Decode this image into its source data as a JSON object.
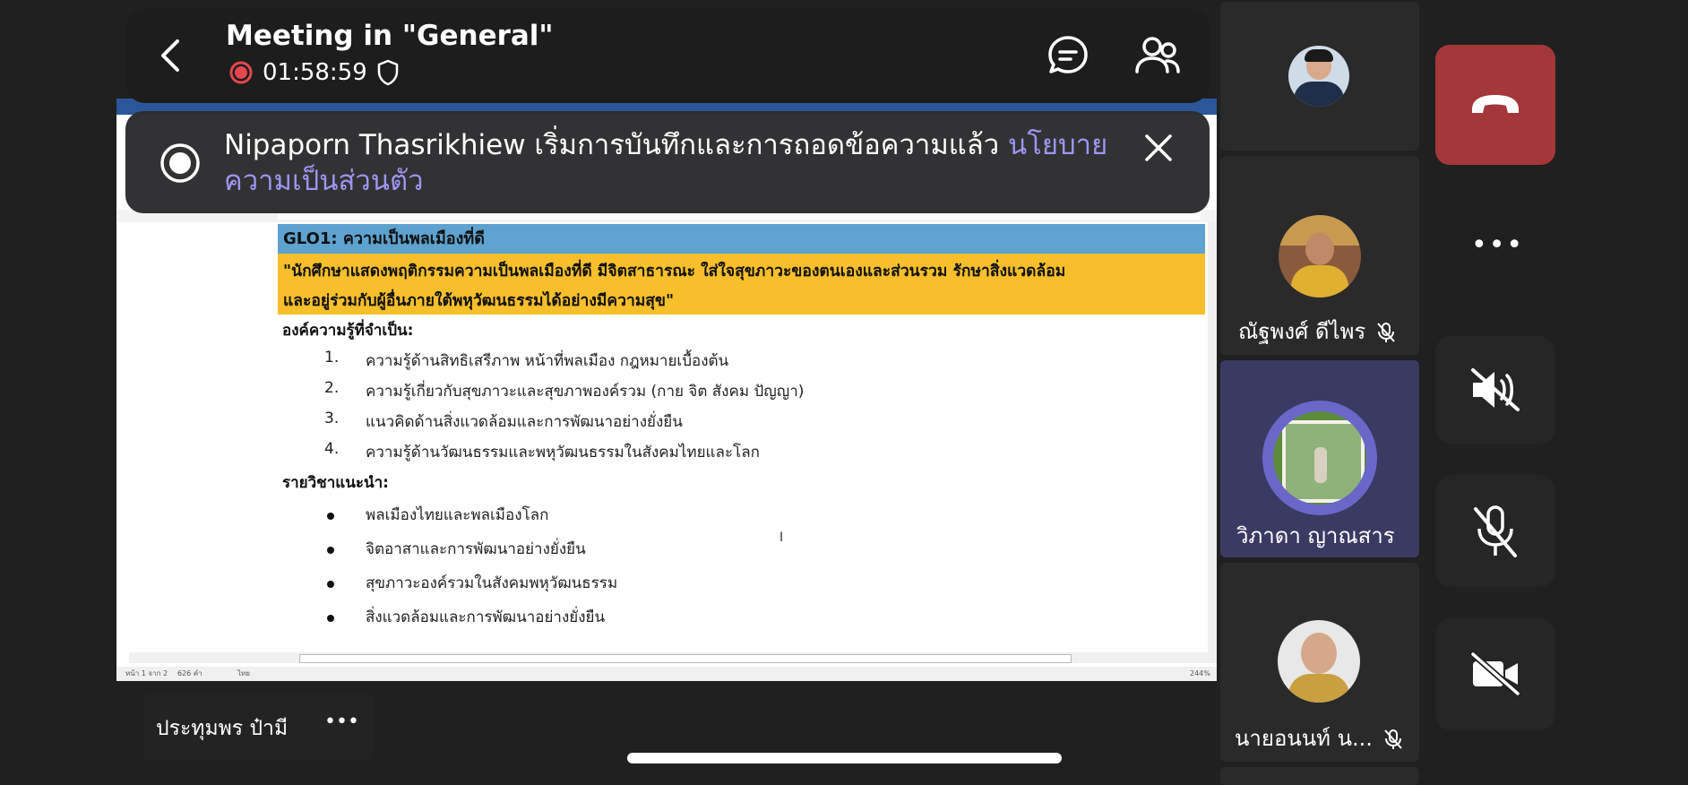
{
  "meeting": {
    "title": "Meeting in \"General\"",
    "timer": "01:58:59"
  },
  "banner": {
    "text": "Nipaporn Thasrikhiew เริ่มการบันทึกและการถอดข้อความแล้ว ",
    "link": "นโยบายความเป็นส่วนตัว"
  },
  "document": {
    "glo_title": "GLO1: ความเป็นพลเมืองที่ดี",
    "quote_line1": "\"นักศึกษาแสดงพฤติกรรมความเป็นพลเมืองที่ดี มีจิตสาธารณะ ใส่ใจสุขภาวะของตนเองและส่วนรวม รักษาสิ่งแวดล้อม",
    "quote_line2": "และอยู่ร่วมกับผู้อื่นภายใต้พหุวัฒนธรรมได้อย่างมีความสุข\"",
    "knowledge_heading": "องค์ความรู้ที่จำเป็น:",
    "knowledge_items": [
      {
        "num": "1.",
        "text": "ความรู้ด้านสิทธิเสรีภาพ หน้าที่พลเมือง กฎหมายเบื้องต้น"
      },
      {
        "num": "2.",
        "text": "ความรู้เกี่ยวกับสุขภาวะและสุขภาพองค์รวม (กาย จิต สังคม ปัญญา)"
      },
      {
        "num": "3.",
        "text": "แนวคิดด้านสิ่งแวดล้อมและการพัฒนาอย่างยั่งยืน"
      },
      {
        "num": "4.",
        "text": "ความรู้ด้านวัฒนธรรมและพหุวัฒนธรรมในสังคมไทยและโลก"
      }
    ],
    "courses_heading": "รายวิชาแนะนำ:",
    "course_items": [
      "พลเมืองไทยและพลเมืองโลก",
      "จิตอาสาและการพัฒนาอย่างยั่งยืน",
      "สุขภาวะองค์รวมในสังคมพหุวัฒนธรรม",
      "สิ่งแวดล้อมและการพัฒนาอย่างยั่งยืน"
    ],
    "status_page": "หน้า 1 จาก 2",
    "status_words": "626 คำ",
    "status_lang": "ไทย",
    "status_zoom": "244%"
  },
  "participants": {
    "p1_name": "",
    "p2_name": "ณัฐพงศ์  ดีไพร",
    "p3_name": "วิภาดา   ญาณสาร",
    "p4_name": "นายอนนท์  น..."
  },
  "presenter": {
    "name": "ประทุมพร  ป๋ามี",
    "more": "•••"
  },
  "controls": {
    "more": "•••"
  },
  "colors": {
    "hangup": "#a4373a",
    "speaking_ring": "#6b67c9",
    "active_tile": "#3a3a63",
    "glo_bg": "#5ea2cf",
    "quote_bg": "#f7bf2b",
    "link": "#9a93f2"
  }
}
